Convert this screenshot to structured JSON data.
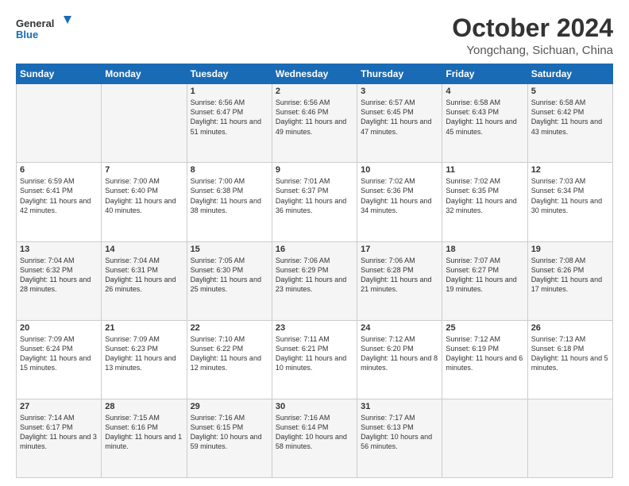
{
  "header": {
    "logo_line1": "General",
    "logo_line2": "Blue",
    "month": "October 2024",
    "location": "Yongchang, Sichuan, China"
  },
  "days_of_week": [
    "Sunday",
    "Monday",
    "Tuesday",
    "Wednesday",
    "Thursday",
    "Friday",
    "Saturday"
  ],
  "weeks": [
    [
      {
        "day": "",
        "info": ""
      },
      {
        "day": "",
        "info": ""
      },
      {
        "day": "1",
        "info": "Sunrise: 6:56 AM\nSunset: 6:47 PM\nDaylight: 11 hours and 51 minutes."
      },
      {
        "day": "2",
        "info": "Sunrise: 6:56 AM\nSunset: 6:46 PM\nDaylight: 11 hours and 49 minutes."
      },
      {
        "day": "3",
        "info": "Sunrise: 6:57 AM\nSunset: 6:45 PM\nDaylight: 11 hours and 47 minutes."
      },
      {
        "day": "4",
        "info": "Sunrise: 6:58 AM\nSunset: 6:43 PM\nDaylight: 11 hours and 45 minutes."
      },
      {
        "day": "5",
        "info": "Sunrise: 6:58 AM\nSunset: 6:42 PM\nDaylight: 11 hours and 43 minutes."
      }
    ],
    [
      {
        "day": "6",
        "info": "Sunrise: 6:59 AM\nSunset: 6:41 PM\nDaylight: 11 hours and 42 minutes."
      },
      {
        "day": "7",
        "info": "Sunrise: 7:00 AM\nSunset: 6:40 PM\nDaylight: 11 hours and 40 minutes."
      },
      {
        "day": "8",
        "info": "Sunrise: 7:00 AM\nSunset: 6:38 PM\nDaylight: 11 hours and 38 minutes."
      },
      {
        "day": "9",
        "info": "Sunrise: 7:01 AM\nSunset: 6:37 PM\nDaylight: 11 hours and 36 minutes."
      },
      {
        "day": "10",
        "info": "Sunrise: 7:02 AM\nSunset: 6:36 PM\nDaylight: 11 hours and 34 minutes."
      },
      {
        "day": "11",
        "info": "Sunrise: 7:02 AM\nSunset: 6:35 PM\nDaylight: 11 hours and 32 minutes."
      },
      {
        "day": "12",
        "info": "Sunrise: 7:03 AM\nSunset: 6:34 PM\nDaylight: 11 hours and 30 minutes."
      }
    ],
    [
      {
        "day": "13",
        "info": "Sunrise: 7:04 AM\nSunset: 6:32 PM\nDaylight: 11 hours and 28 minutes."
      },
      {
        "day": "14",
        "info": "Sunrise: 7:04 AM\nSunset: 6:31 PM\nDaylight: 11 hours and 26 minutes."
      },
      {
        "day": "15",
        "info": "Sunrise: 7:05 AM\nSunset: 6:30 PM\nDaylight: 11 hours and 25 minutes."
      },
      {
        "day": "16",
        "info": "Sunrise: 7:06 AM\nSunset: 6:29 PM\nDaylight: 11 hours and 23 minutes."
      },
      {
        "day": "17",
        "info": "Sunrise: 7:06 AM\nSunset: 6:28 PM\nDaylight: 11 hours and 21 minutes."
      },
      {
        "day": "18",
        "info": "Sunrise: 7:07 AM\nSunset: 6:27 PM\nDaylight: 11 hours and 19 minutes."
      },
      {
        "day": "19",
        "info": "Sunrise: 7:08 AM\nSunset: 6:26 PM\nDaylight: 11 hours and 17 minutes."
      }
    ],
    [
      {
        "day": "20",
        "info": "Sunrise: 7:09 AM\nSunset: 6:24 PM\nDaylight: 11 hours and 15 minutes."
      },
      {
        "day": "21",
        "info": "Sunrise: 7:09 AM\nSunset: 6:23 PM\nDaylight: 11 hours and 13 minutes."
      },
      {
        "day": "22",
        "info": "Sunrise: 7:10 AM\nSunset: 6:22 PM\nDaylight: 11 hours and 12 minutes."
      },
      {
        "day": "23",
        "info": "Sunrise: 7:11 AM\nSunset: 6:21 PM\nDaylight: 11 hours and 10 minutes."
      },
      {
        "day": "24",
        "info": "Sunrise: 7:12 AM\nSunset: 6:20 PM\nDaylight: 11 hours and 8 minutes."
      },
      {
        "day": "25",
        "info": "Sunrise: 7:12 AM\nSunset: 6:19 PM\nDaylight: 11 hours and 6 minutes."
      },
      {
        "day": "26",
        "info": "Sunrise: 7:13 AM\nSunset: 6:18 PM\nDaylight: 11 hours and 5 minutes."
      }
    ],
    [
      {
        "day": "27",
        "info": "Sunrise: 7:14 AM\nSunset: 6:17 PM\nDaylight: 11 hours and 3 minutes."
      },
      {
        "day": "28",
        "info": "Sunrise: 7:15 AM\nSunset: 6:16 PM\nDaylight: 11 hours and 1 minute."
      },
      {
        "day": "29",
        "info": "Sunrise: 7:16 AM\nSunset: 6:15 PM\nDaylight: 10 hours and 59 minutes."
      },
      {
        "day": "30",
        "info": "Sunrise: 7:16 AM\nSunset: 6:14 PM\nDaylight: 10 hours and 58 minutes."
      },
      {
        "day": "31",
        "info": "Sunrise: 7:17 AM\nSunset: 6:13 PM\nDaylight: 10 hours and 56 minutes."
      },
      {
        "day": "",
        "info": ""
      },
      {
        "day": "",
        "info": ""
      }
    ]
  ]
}
